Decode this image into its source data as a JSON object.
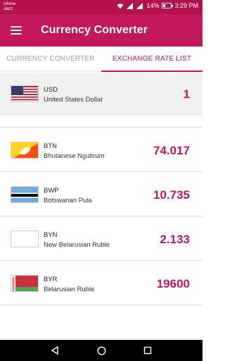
{
  "status_bar": {
    "carrier_line1": "Ufone",
    "carrier_line2": "Jazz",
    "battery": "14%",
    "time": "3:29 PM"
  },
  "app_bar": {
    "title": "Currency Converter",
    "menu_icon": "hamburger-menu-icon"
  },
  "tabs": [
    {
      "label": "CURRENCY CONVERTER",
      "active": false
    },
    {
      "label": "EXCHANGE RATE LIST",
      "active": true
    }
  ],
  "base_currency": {
    "code": "USD",
    "name": "United States Dollar",
    "value": "1",
    "flag": "us-flag-icon"
  },
  "rates": [
    {
      "code": "BTN",
      "name": "Bhutanese Ngultrum",
      "value": "74.017",
      "flag": "bhutan-flag-icon"
    },
    {
      "code": "BWP",
      "name": "Botswanan Pula",
      "value": "10.735",
      "flag": "botswana-flag-icon"
    },
    {
      "code": "BYN",
      "name": "New Belarusian Ruble",
      "value": "2.133",
      "flag": "blank-flag-icon"
    },
    {
      "code": "BYR",
      "name": "Belarusian Ruble",
      "value": "19600",
      "flag": "belarus-flag-icon"
    }
  ],
  "colors": {
    "primary": "#c2185b",
    "status_bar": "#b3124e",
    "accent_text": "#c2185b"
  },
  "nav_bar": {
    "back_icon": "back-triangle-icon",
    "home_icon": "home-circle-icon",
    "recents_icon": "recents-square-icon"
  }
}
